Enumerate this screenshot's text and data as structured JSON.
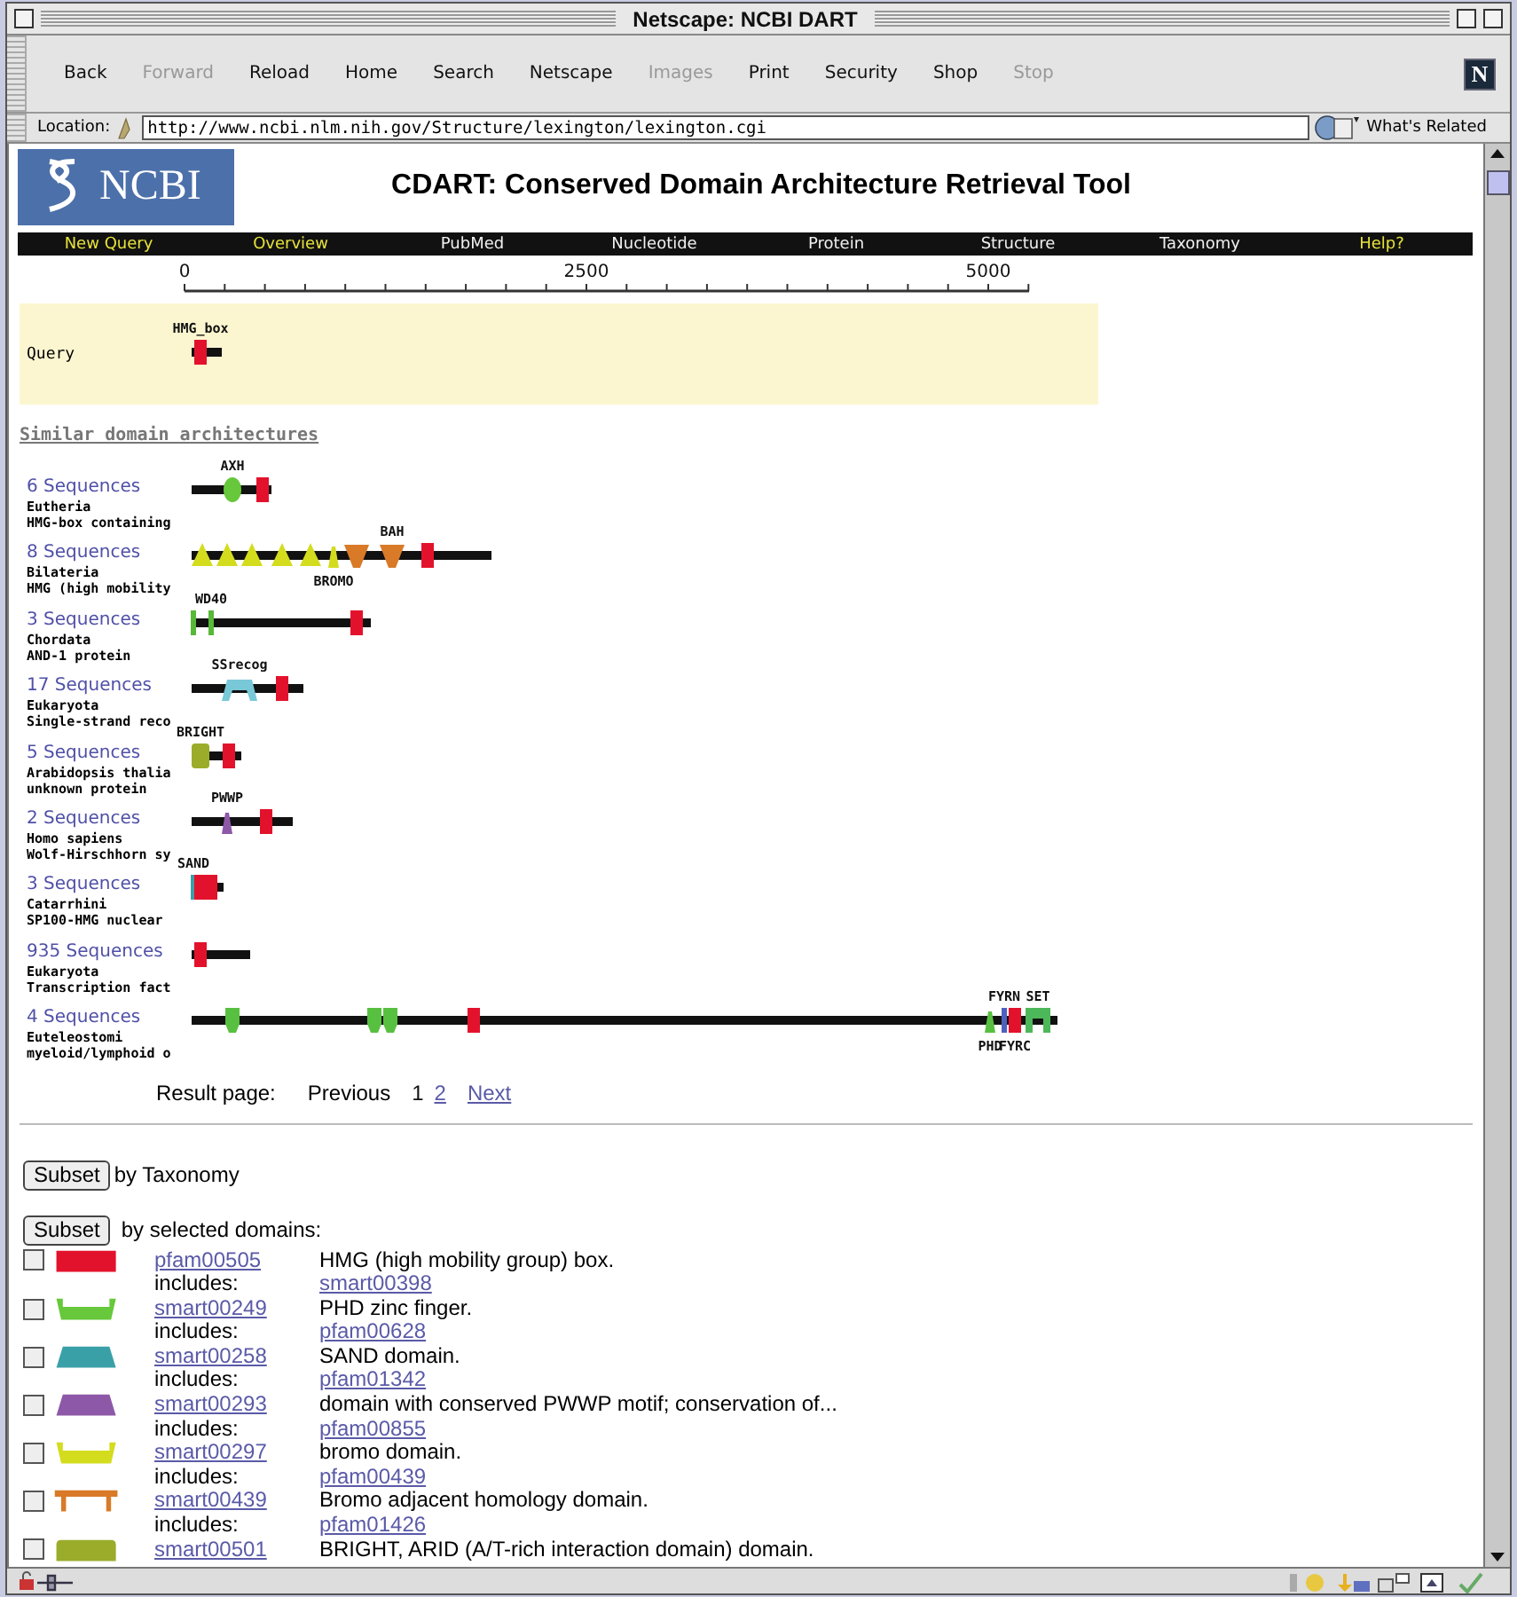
{
  "window": {
    "title": "Netscape: NCBI DART"
  },
  "toolbar": [
    {
      "label": "Back",
      "disabled": false
    },
    {
      "label": "Forward",
      "disabled": true
    },
    {
      "label": "Reload",
      "disabled": false
    },
    {
      "label": "Home",
      "disabled": false
    },
    {
      "label": "Search",
      "disabled": false
    },
    {
      "label": "Netscape",
      "disabled": false
    },
    {
      "label": "Images",
      "disabled": true
    },
    {
      "label": "Print",
      "disabled": false
    },
    {
      "label": "Security",
      "disabled": false
    },
    {
      "label": "Shop",
      "disabled": false
    },
    {
      "label": "Stop",
      "disabled": true
    }
  ],
  "brand_button": "N",
  "location": {
    "label": "Location:",
    "url": "http://www.ncbi.nlm.nih.gov/Structure/lexington/lexington.cgi"
  },
  "whats_related": "What's Related",
  "logo": {
    "text": "NCBI"
  },
  "page_title": "CDART: Conserved Domain Architecture Retrieval Tool",
  "nav": [
    {
      "label": "New Query",
      "color": "#e6e23a"
    },
    {
      "label": "Overview",
      "color": "#e6e23a"
    },
    {
      "label": "PubMed",
      "color": "#f0f0f0"
    },
    {
      "label": "Nucleotide",
      "color": "#f0f0f0"
    },
    {
      "label": "Protein",
      "color": "#f0f0f0"
    },
    {
      "label": "Structure",
      "color": "#f0f0f0"
    },
    {
      "label": "Taxonomy",
      "color": "#f0f0f0"
    },
    {
      "label": "Help?",
      "color": "#e6e23a"
    }
  ],
  "ruler": {
    "ticks": [
      "0",
      "2500",
      "5000"
    ]
  },
  "query": {
    "label": "Query",
    "domains": [
      {
        "kind": "box",
        "color": "#e3122c",
        "label": "HMG_box"
      }
    ]
  },
  "similar_heading": "Similar domain architectures",
  "architectures": [
    {
      "link": "6 Sequences",
      "taxon": "Eutheria",
      "description": "HMG-box containing",
      "domains": [
        {
          "kind": "oval",
          "color": "#66c83a",
          "label": "AXH"
        },
        {
          "kind": "box",
          "color": "#e3122c"
        }
      ]
    },
    {
      "link": "8 Sequences",
      "taxon": "Bilateria",
      "description": "HMG (high mobility",
      "domains": [
        {
          "kind": "triangle",
          "color": "#d4dc1e"
        },
        {
          "kind": "triangle",
          "color": "#d4dc1e"
        },
        {
          "kind": "triangle",
          "color": "#d4dc1e"
        },
        {
          "kind": "triangle",
          "color": "#d4dc1e"
        },
        {
          "kind": "triangle",
          "color": "#d4dc1e"
        },
        {
          "kind": "spike",
          "color": "#d4dc1e",
          "label": "BROMO"
        },
        {
          "kind": "table",
          "color": "#d87a28"
        },
        {
          "kind": "table",
          "color": "#d87a28",
          "label": "BAH"
        },
        {
          "kind": "box",
          "color": "#e3122c"
        }
      ]
    },
    {
      "link": "3 Sequences",
      "taxon": "Chordata",
      "description": "AND-1 protein",
      "domains": [
        {
          "kind": "tick",
          "color": "#58b838"
        },
        {
          "kind": "tick",
          "color": "#58b838",
          "label": "WD40"
        },
        {
          "kind": "box",
          "color": "#e3122c"
        }
      ]
    },
    {
      "link": "17 Sequences",
      "taxon": "Eukaryota",
      "description": "Single-strand reco",
      "domains": [
        {
          "kind": "trapezoid",
          "color": "#78c8d8",
          "label": "SSrecog"
        },
        {
          "kind": "box",
          "color": "#e3122c"
        }
      ]
    },
    {
      "link": "5 Sequences",
      "taxon": "Arabidopsis thalia",
      "description": "unknown protein",
      "domains": [
        {
          "kind": "rounded",
          "color": "#9aac2a",
          "label": "BRIGHT"
        },
        {
          "kind": "box",
          "color": "#e3122c"
        }
      ]
    },
    {
      "link": "2 Sequences",
      "taxon": "Homo sapiens",
      "description": "Wolf-Hirschhorn sy",
      "domains": [
        {
          "kind": "spike",
          "color": "#8e58a8",
          "label": "PWWP"
        },
        {
          "kind": "box",
          "color": "#e3122c"
        }
      ]
    },
    {
      "link": "3 Sequences",
      "taxon": "Catarrhini",
      "description": "SP100-HMG nuclear",
      "domains": [
        {
          "kind": "tick",
          "color": "#3aa0a8",
          "label": "SAND"
        },
        {
          "kind": "box",
          "color": "#e3122c"
        },
        {
          "kind": "box",
          "color": "#e3122c"
        }
      ]
    },
    {
      "link": "935 Sequences",
      "taxon": "Eukaryota",
      "description": "Transcription fact",
      "domains": [
        {
          "kind": "box",
          "color": "#e3122c"
        }
      ]
    },
    {
      "link": "4 Sequences",
      "taxon": "Euteleostomi",
      "description": "myeloid/lymphoid o",
      "domains": [
        {
          "kind": "cup",
          "color": "#58c040"
        },
        {
          "kind": "cup",
          "color": "#58c040"
        },
        {
          "kind": "cup",
          "color": "#58c040"
        },
        {
          "kind": "box",
          "color": "#e3122c"
        },
        {
          "kind": "spike",
          "color": "#58c040",
          "label": "PHD"
        },
        {
          "kind": "tick",
          "color": "#5060c0",
          "label": "FYRN"
        },
        {
          "kind": "box",
          "color": "#e3122c",
          "label": "FYRC"
        },
        {
          "kind": "wide",
          "color": "#4cb85a",
          "label": "SET"
        }
      ]
    }
  ],
  "pagination": {
    "label": "Result page:",
    "previous": "Previous",
    "pages": [
      {
        "label": "1",
        "selected": true
      },
      {
        "label": "2",
        "selected": false
      }
    ],
    "next": "Next"
  },
  "subset_taxonomy": {
    "button": "Subset",
    "text": "by Taxonomy"
  },
  "subset_domains": {
    "button": "Subset",
    "text": "by selected domains:"
  },
  "domain_list": [
    {
      "checked": false,
      "kind": "box",
      "color": "#e3122c",
      "accession": "pfam00505",
      "description": "HMG (high mobility group) box.",
      "includes_label": "includes:",
      "includes": "smart00398"
    },
    {
      "checked": false,
      "kind": "cup",
      "color": "#66c83a",
      "accession": "smart00249",
      "description": "PHD zinc finger.",
      "includes_label": "includes:",
      "includes": "pfam00628"
    },
    {
      "checked": false,
      "kind": "trapezoid",
      "color": "#3aa0a8",
      "accession": "smart00258",
      "description": "SAND domain.",
      "includes_label": "includes:",
      "includes": "pfam01342"
    },
    {
      "checked": false,
      "kind": "trapezoid",
      "color": "#8e58a8",
      "accession": "smart00293",
      "description": "domain with conserved PWWP motif; conservation of...",
      "includes_label": "includes:",
      "includes": "pfam00855"
    },
    {
      "checked": false,
      "kind": "cup",
      "color": "#d4dc1e",
      "accession": "smart00297",
      "description": "bromo domain.",
      "includes_label": "includes:",
      "includes": "pfam00439"
    },
    {
      "checked": false,
      "kind": "table",
      "color": "#d87a28",
      "accession": "smart00439",
      "description": "Bromo adjacent homology domain.",
      "includes_label": "includes:",
      "includes": "pfam01426"
    },
    {
      "checked": false,
      "kind": "rounded",
      "color": "#9aac2a",
      "accession": "smart00501",
      "description": "BRIGHT, ARID (A/T-rich interaction domain) domain."
    }
  ]
}
